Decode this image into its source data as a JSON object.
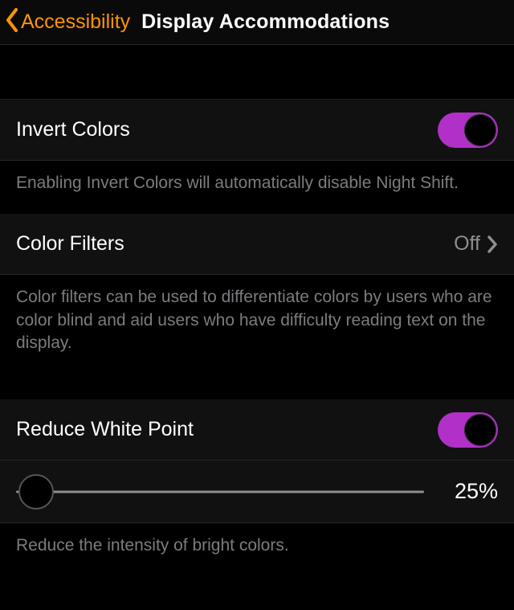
{
  "nav": {
    "back_label": "Accessibility",
    "title": "Display Accommodations"
  },
  "invert_colors": {
    "label": "Invert Colors",
    "enabled": true,
    "footer": "Enabling Invert Colors will automatically disable Night Shift."
  },
  "color_filters": {
    "label": "Color Filters",
    "value": "Off",
    "footer": "Color filters can be used to differentiate colors by users who are color blind and aid users who have difficulty reading text on the display."
  },
  "reduce_white_point": {
    "label": "Reduce White Point",
    "enabled": true,
    "slider_percent": 25,
    "slider_display": "25%",
    "footer": "Reduce the intensity of bright colors."
  },
  "colors": {
    "accent": "#ff9500",
    "toggle": "#b030c8"
  }
}
